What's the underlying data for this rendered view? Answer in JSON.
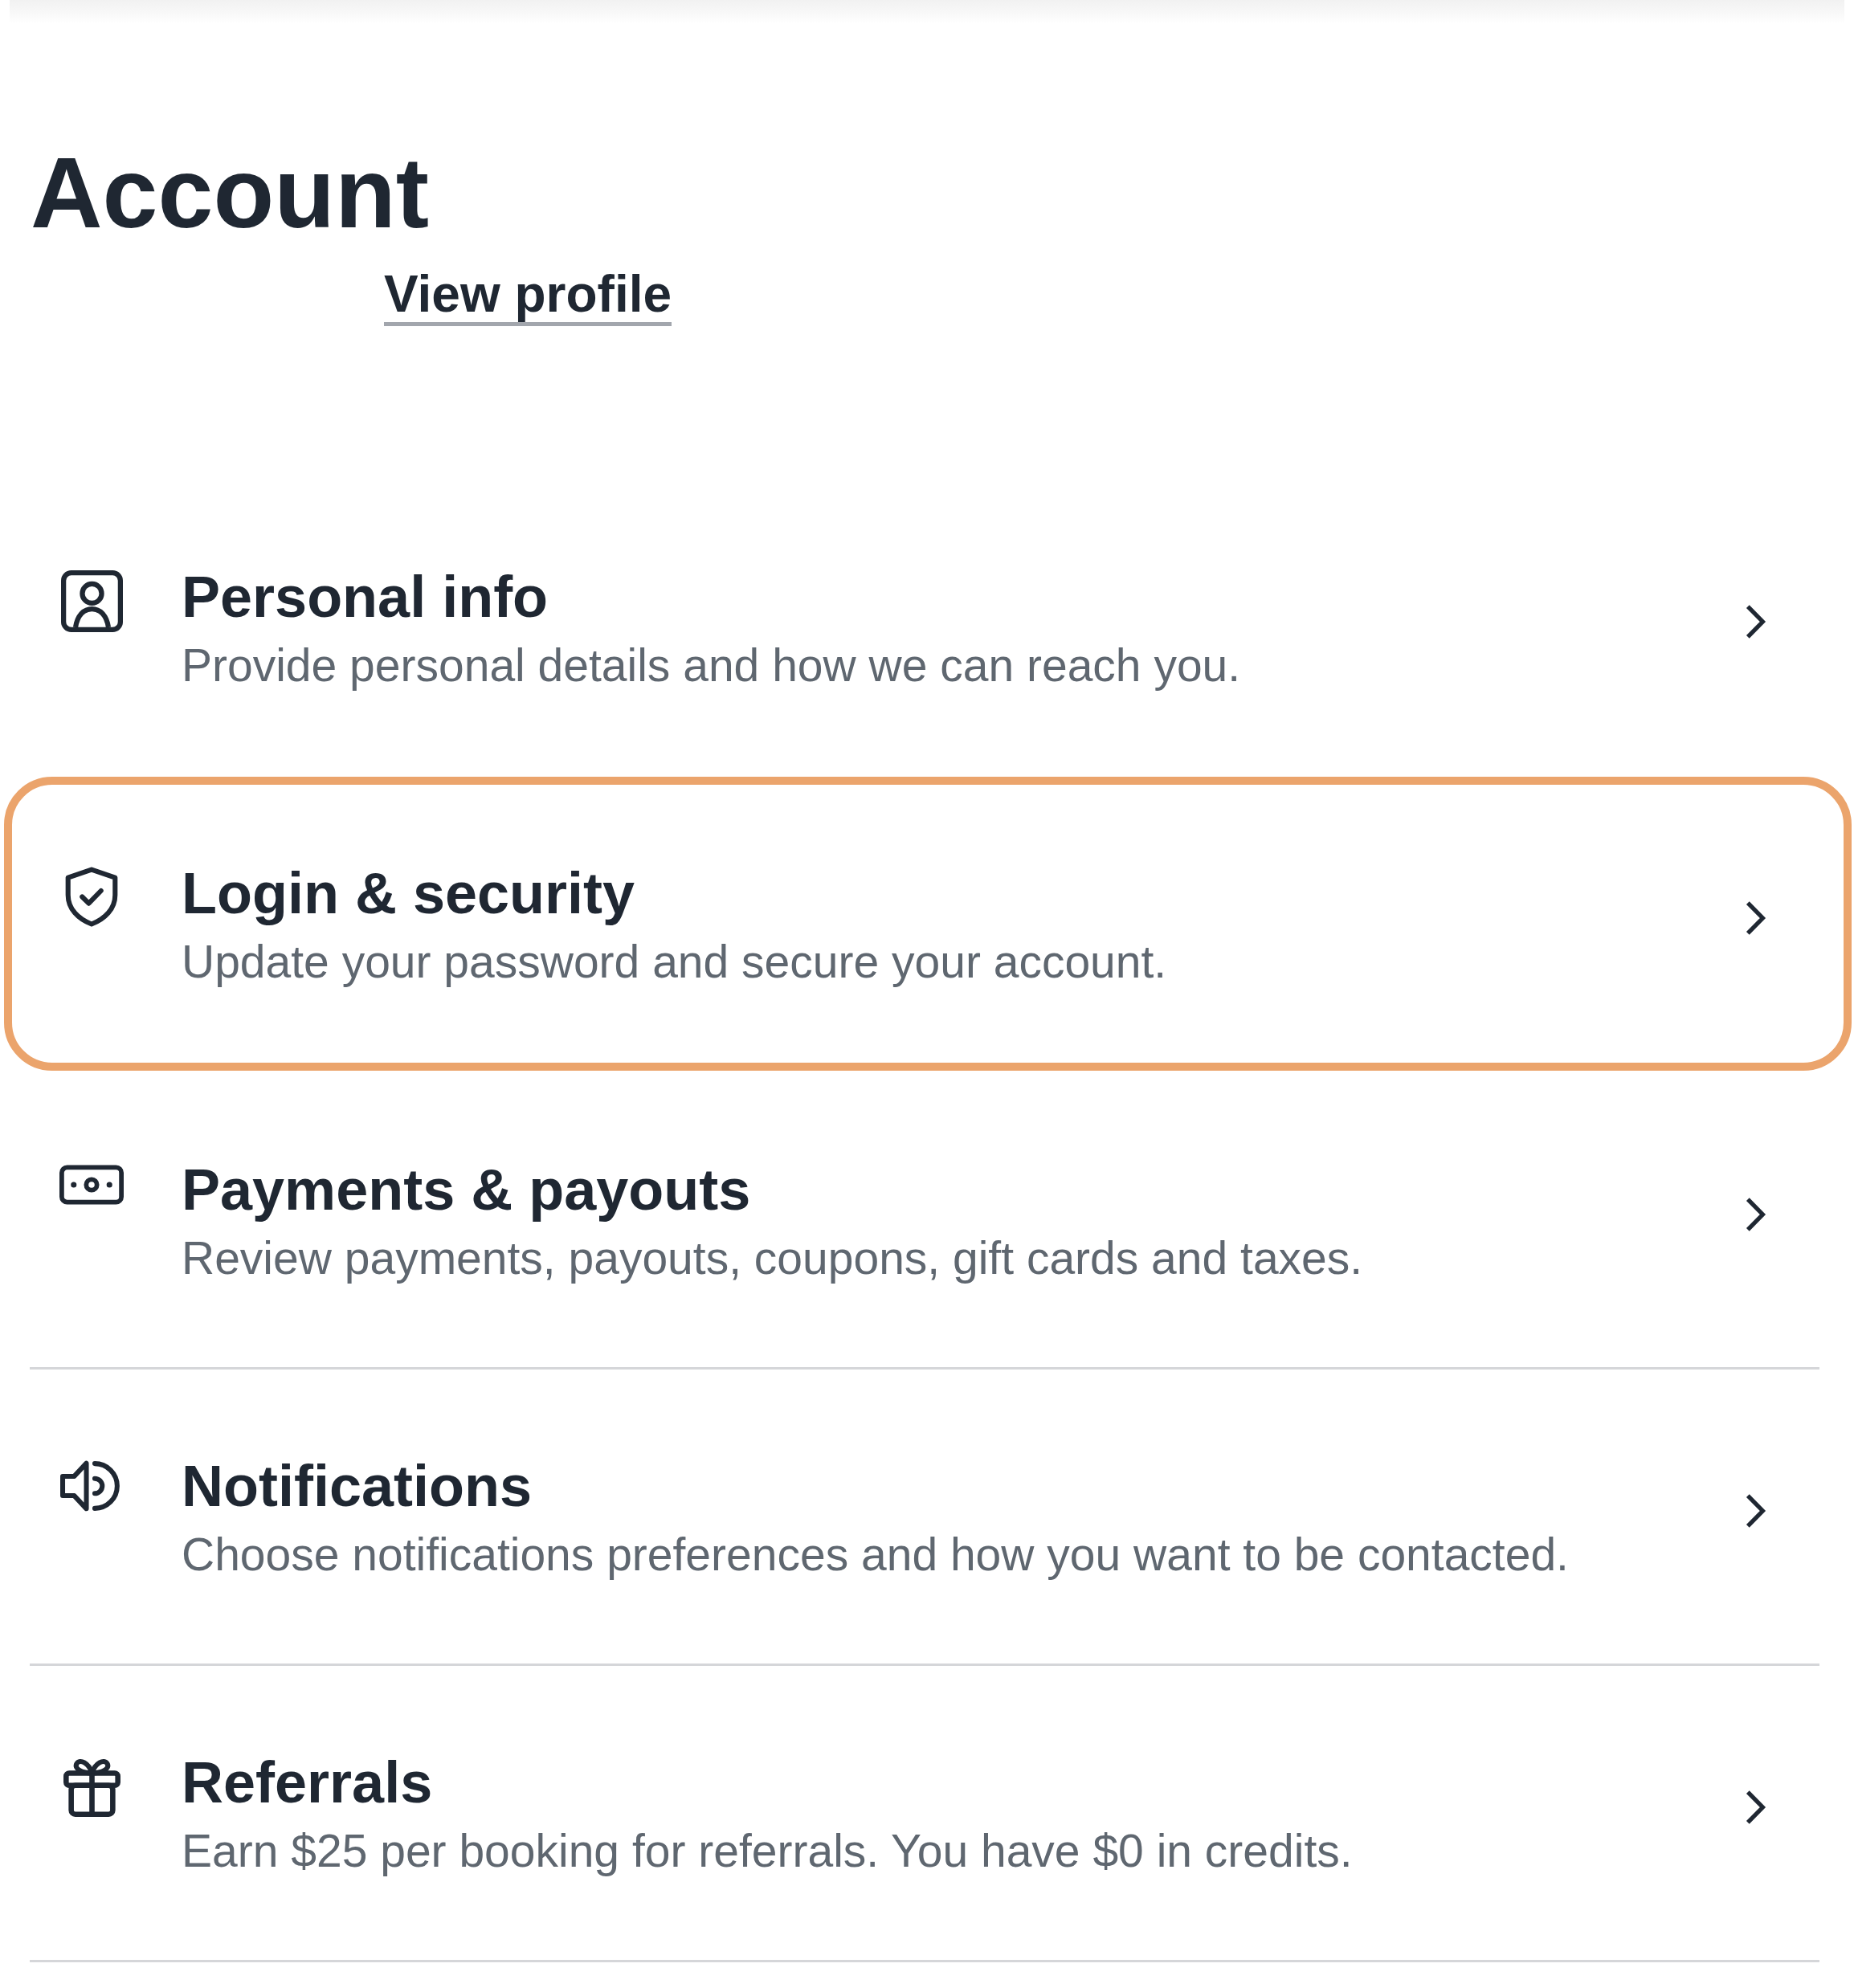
{
  "header": {
    "title": "Account",
    "profile_link": "View profile"
  },
  "settings": [
    {
      "kind": "person",
      "title": "Personal info",
      "description": "Provide personal details and how we can reach you.",
      "selected": false
    },
    {
      "kind": "shield",
      "title": "Login & security",
      "description": "Update your password and secure your account.",
      "selected": true
    },
    {
      "kind": "banknote",
      "title": "Payments & payouts",
      "description": "Review payments, payouts, coupons, gift cards and taxes.",
      "selected": false
    },
    {
      "kind": "speaker",
      "title": "Notifications",
      "description": "Choose notifications preferences and how you want to be contacted.",
      "selected": false
    },
    {
      "kind": "gift",
      "title": "Referrals",
      "description": "Earn $25 per booking for referrals. You have $0 in credits.",
      "selected": false
    }
  ]
}
